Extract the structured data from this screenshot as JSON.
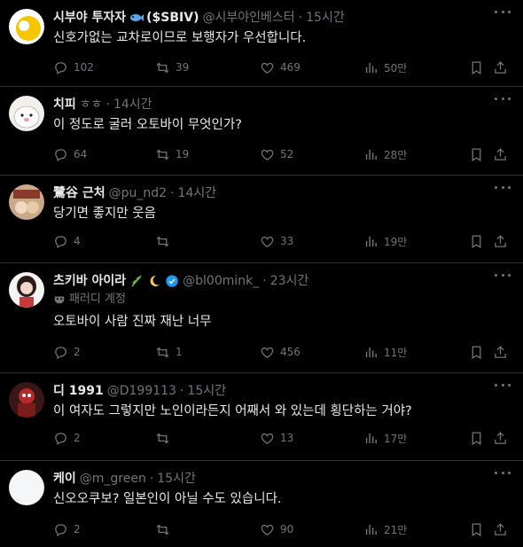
{
  "tweets": [
    {
      "name": "시부야 투자자",
      "name_suffix": "($SBIV)",
      "handle": "@시부야인베스터",
      "time": "15시간",
      "text": "신호가없는 교차로이므로 보행자가 우선합니다.",
      "replies": "102",
      "retweets": "39",
      "likes": "469",
      "views": "50만"
    },
    {
      "name": "치피",
      "handle": "ㅎㅎ",
      "time": "14시간",
      "text": "이 정도로 굴러 오토바이 무엇인가?",
      "replies": "64",
      "retweets": "19",
      "likes": "52",
      "views": "28만"
    },
    {
      "name": "鷺谷 근처",
      "handle": "@pu_nd2",
      "time": "14시간",
      "text": "당기면 좋지만 웃음",
      "replies": "4",
      "retweets": "",
      "likes": "33",
      "views": "19만"
    },
    {
      "name": "츠키바 아이라",
      "handle": "@bl00mink_",
      "time": "23시간",
      "parody": "패러디 계정",
      "text": "오토바이 사람 진짜 재난 너무",
      "replies": "2",
      "retweets": "1",
      "likes": "456",
      "views": "11만"
    },
    {
      "name": "디 1991",
      "handle": "@D199113",
      "time": "15시간",
      "text": "이 여자도 그렇지만 노인이라든지 어째서 와 있는데 횡단하는 거야?",
      "replies": "2",
      "retweets": "",
      "likes": "13",
      "views": "17만"
    },
    {
      "name": "케이",
      "handle": "@m_green",
      "time": "15시간",
      "text": "신오오쿠보? 일본인이 아닐 수도 있습니다.",
      "replies": "2",
      "retweets": "",
      "likes": "90",
      "views": "21만"
    }
  ],
  "colors": {
    "background": "#000000",
    "text": "#e7e9ea",
    "muted": "#71767b",
    "border": "#2f3336",
    "verified": "#1d9bf0"
  }
}
